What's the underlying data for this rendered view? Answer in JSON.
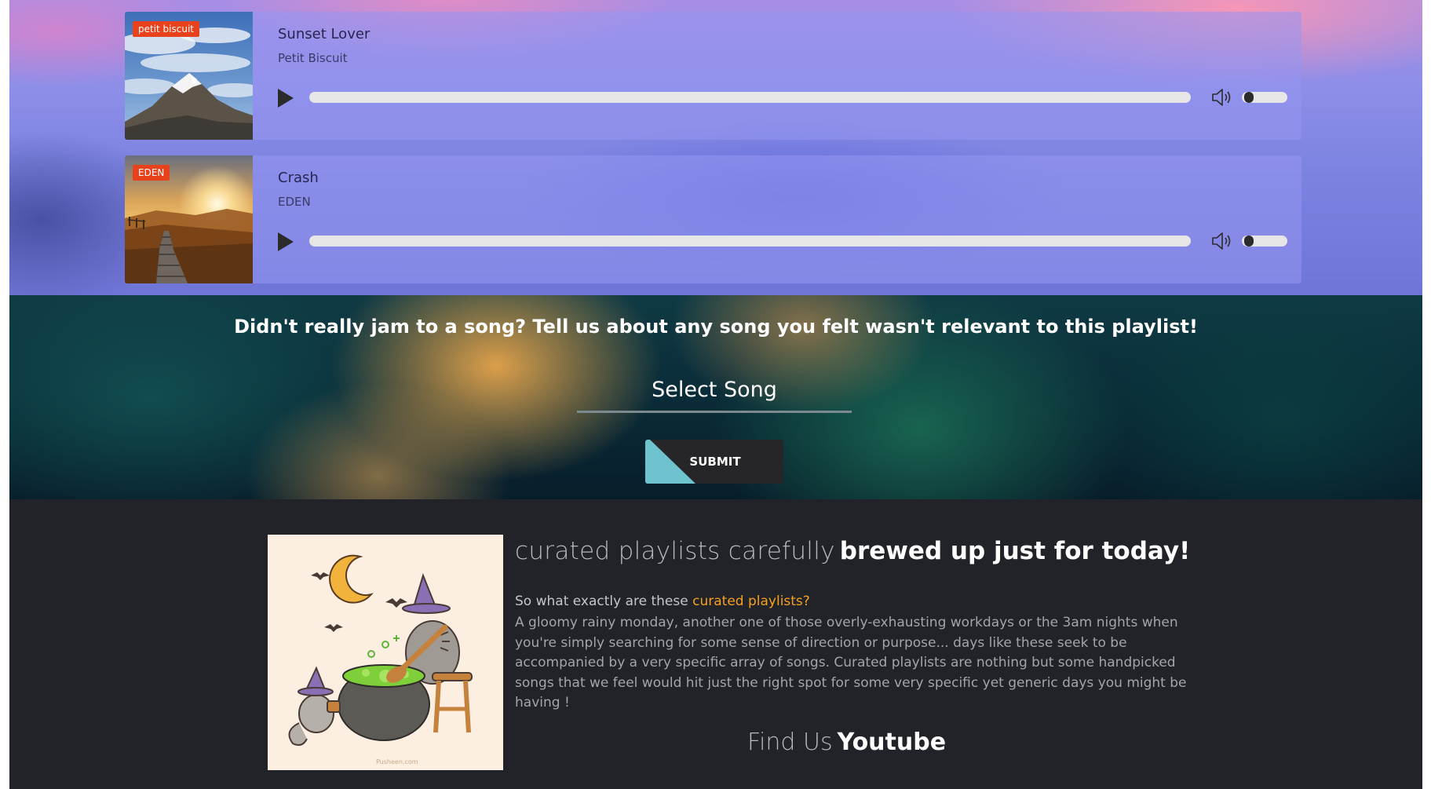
{
  "songs": [
    {
      "badge": "petit biscuit",
      "title": "Sunset Lover",
      "artist": "Petit Biscuit",
      "cover_icon": "mountain-cover-image",
      "volume_level": 0.15
    },
    {
      "badge": "EDEN",
      "title": "Crash",
      "artist": "EDEN",
      "cover_icon": "sunset-path-cover-image",
      "volume_level": 0.15
    }
  ],
  "feedback": {
    "heading": "Didn't really jam to a song? Tell us about any song you felt wasn't relevant to this playlist!",
    "select_label": "Select Song",
    "submit_label": "SUBMIT",
    "accent_color": "#6fc3cf"
  },
  "about": {
    "headline_light": "curated playlists carefully",
    "headline_bold": "brewed up just for today!",
    "question_prefix": "So what exactly are these ",
    "question_highlight": "curated playlists?",
    "body": "A gloomy rainy monday, another one of those overly-exhausting workdays or the 3am nights when you're simply searching for some sense of direction or purpose... days like these seek to be accompanied by a very specific array of songs. Curated playlists are nothing but some handpicked songs that we feel would hit just the right spot for some very specific yet generic days you might be having !",
    "image_icon": "pusheen-witch-cauldron-illustration",
    "image_caption": "Pusheen.com",
    "highlight_color": "#f5a020"
  },
  "footer": {
    "find_us_label": "Find Us",
    "youtube_label": "Youtube"
  }
}
